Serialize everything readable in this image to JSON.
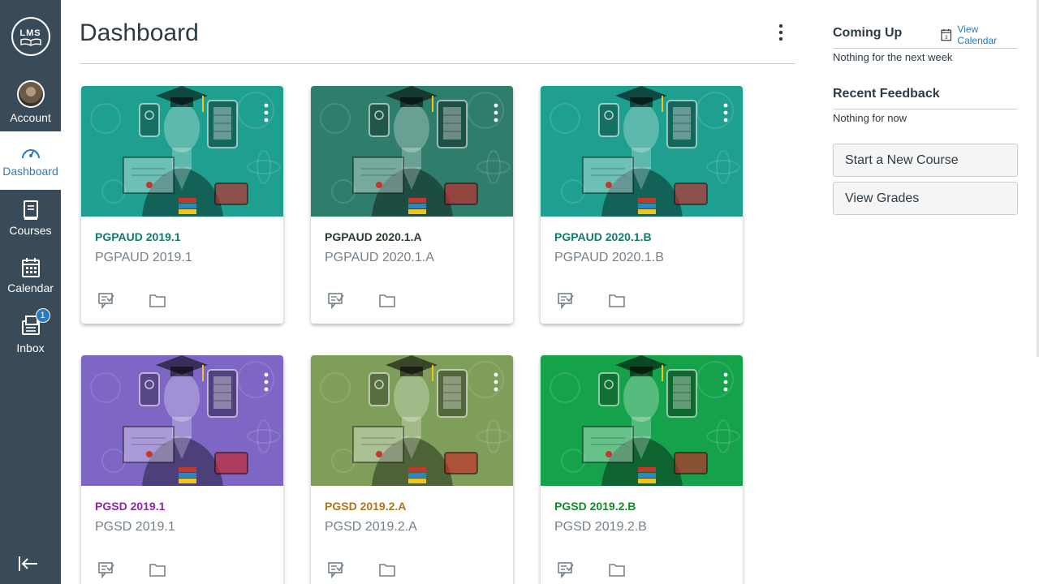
{
  "app": {
    "logo_text": "LMS"
  },
  "nav": {
    "items": [
      {
        "label": "Account",
        "icon": "avatar"
      },
      {
        "label": "Dashboard",
        "icon": "dashboard-icon",
        "active": true
      },
      {
        "label": "Courses",
        "icon": "courses-icon"
      },
      {
        "label": "Calendar",
        "icon": "calendar-icon"
      },
      {
        "label": "Inbox",
        "icon": "inbox-icon",
        "badge": "1"
      }
    ],
    "collapse_icon": "collapse-nav-icon"
  },
  "main": {
    "title": "Dashboard"
  },
  "courses": [
    {
      "code": "PGPAUD 2019.1",
      "name": "PGPAUD 2019.1",
      "color": "#1f9f8f",
      "code_color": "#127a6c"
    },
    {
      "code": "PGPAUD 2020.1.A",
      "name": "PGPAUD 2020.1.A",
      "color": "#2f7d6b",
      "code_color": "#2b3c2f"
    },
    {
      "code": "PGPAUD 2020.1.B",
      "name": "PGPAUD 2020.1.B",
      "color": "#1f9f8f",
      "code_color": "#127a6c"
    },
    {
      "code": "PGSD 2019.1",
      "name": "PGSD 2019.1",
      "color": "#7d66c4",
      "code_color": "#8a2aa8"
    },
    {
      "code": "PGSD 2019.2.A",
      "name": "PGSD 2019.2.A",
      "color": "#7f9e5a",
      "code_color": "#b0751b"
    },
    {
      "code": "PGSD 2019.2.B",
      "name": "PGSD 2019.2.B",
      "color": "#16a24b",
      "code_color": "#148a2a"
    }
  ],
  "sidebar": {
    "coming_up_title": "Coming Up",
    "view_calendar": "View Calendar",
    "coming_up_text": "Nothing for the next week",
    "feedback_title": "Recent Feedback",
    "feedback_text": "Nothing for now",
    "start_course": "Start a New Course",
    "view_grades": "View Grades",
    "calendar_icon_day": "3"
  }
}
